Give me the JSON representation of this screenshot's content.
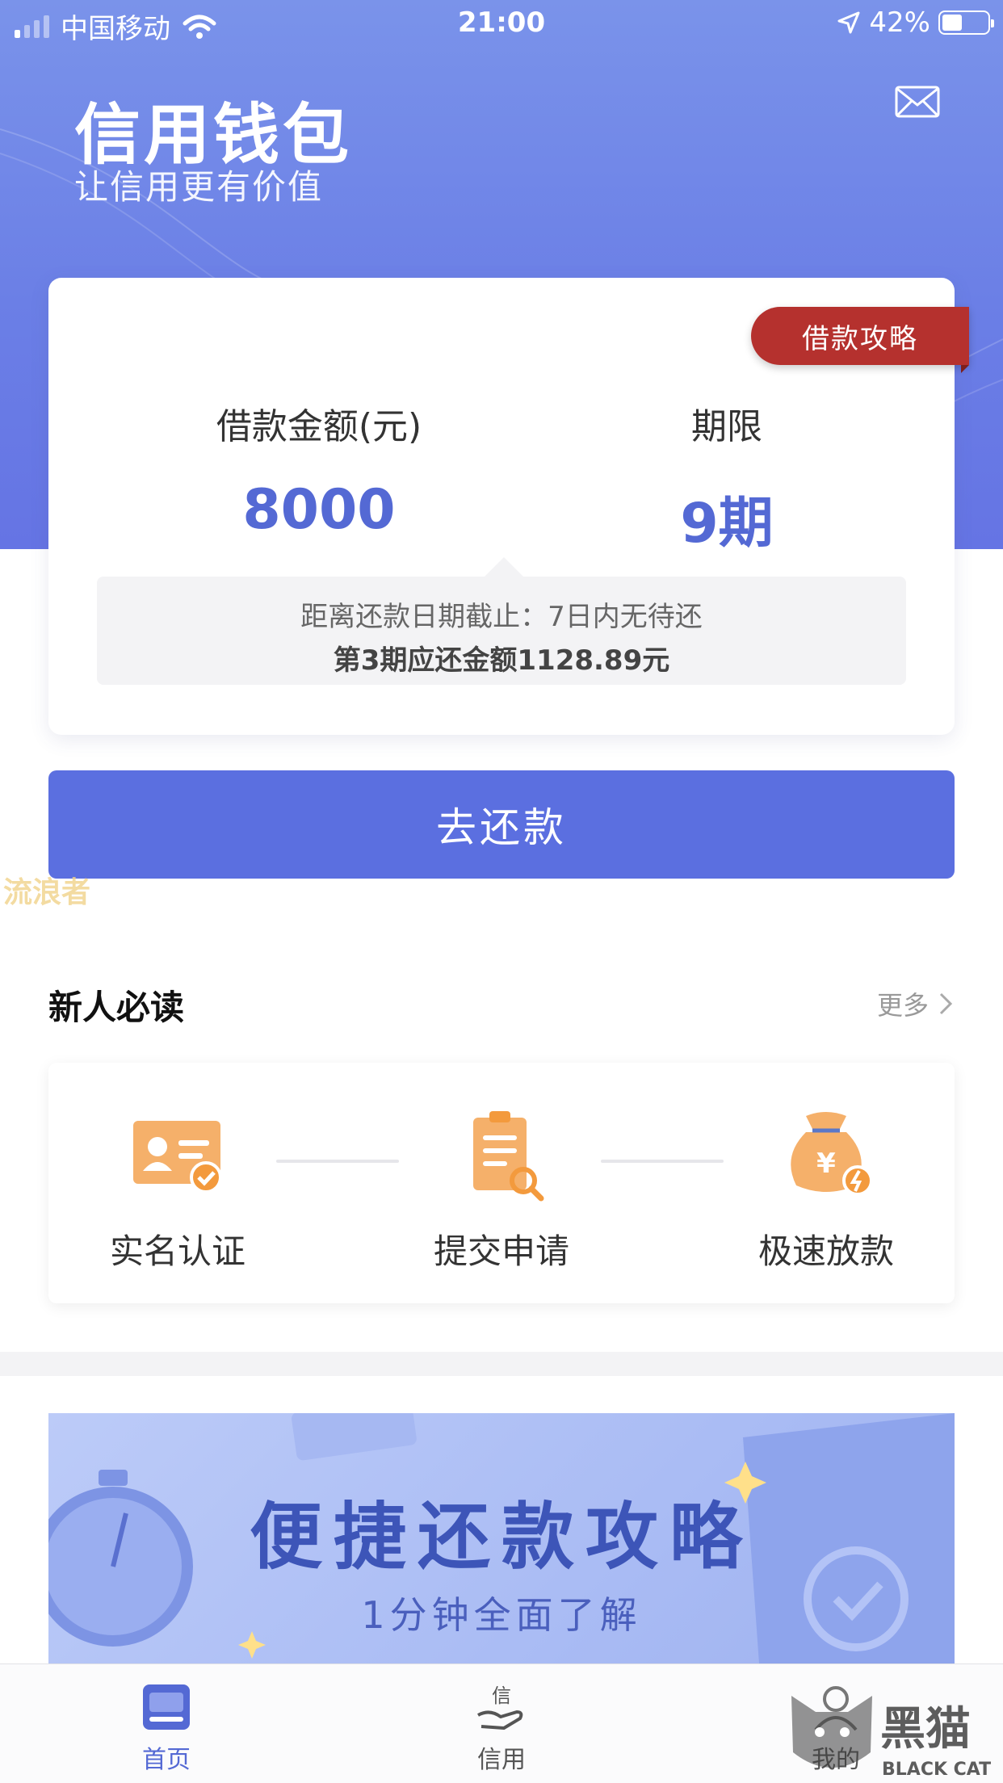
{
  "status_bar": {
    "carrier": "中国移动",
    "time": "21:00",
    "battery": "42%",
    "icons": [
      "signal-icon",
      "wifi-icon",
      "location-arrow-icon",
      "battery-icon"
    ]
  },
  "header": {
    "title": "信用钱包",
    "subtitle": "让信用更有价值",
    "mail_icon": "mail-icon"
  },
  "loan_card": {
    "guide_tag": "借款攻略",
    "amount_label": "借款金额(元)",
    "amount_value": "8000",
    "term_label": "期限",
    "term_value": "9期",
    "due_info": "距离还款日期截止：7日内无待还",
    "installment_info": "第3期应还金额1128.89元"
  },
  "repay_button": "去还款",
  "watermark": "流浪者",
  "newbie": {
    "title": "新人必读",
    "more": "更多",
    "steps": [
      {
        "label": "实名认证",
        "icon": "id-card-icon"
      },
      {
        "label": "提交申请",
        "icon": "clipboard-icon"
      },
      {
        "label": "极速放款",
        "icon": "money-bag-icon"
      }
    ]
  },
  "banner": {
    "title": "便捷还款攻略",
    "subtitle": "1分钟全面了解"
  },
  "tabbar": {
    "tabs": [
      {
        "label": "首页",
        "icon": "home-card-icon",
        "active": true
      },
      {
        "label": "信用",
        "icon": "credit-hand-icon",
        "active": false
      },
      {
        "label": "我的",
        "icon": "profile-icon",
        "active": false
      }
    ]
  },
  "corner_logo": {
    "text": "黑猫",
    "subtext": "BLACK CAT"
  },
  "colors": {
    "primary": "#5b6fe0",
    "accent_red": "#b5312e",
    "value_blue": "#5469d4"
  }
}
